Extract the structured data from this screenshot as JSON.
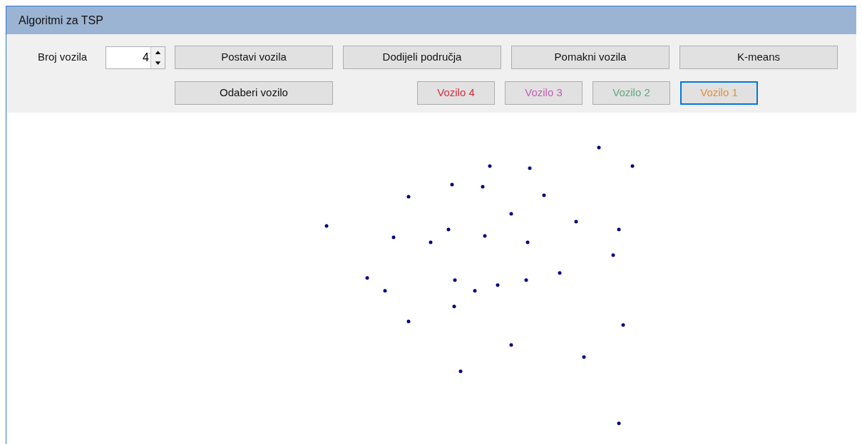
{
  "window": {
    "title": "Algoritmi za TSP"
  },
  "vehicle_count": {
    "label": "Broj vozila",
    "value": "4"
  },
  "actions": [
    {
      "label": "Postavi vozila"
    },
    {
      "label": "Dodijeli područja"
    },
    {
      "label": "Pomakni vozila"
    },
    {
      "label": "K-means"
    }
  ],
  "select_button": {
    "label": "Odaberi vozilo"
  },
  "vehicles": [
    {
      "label": "Vozilo 4",
      "color": "#d0303c",
      "selected": false
    },
    {
      "label": "Vozilo 3",
      "color": "#c060b0",
      "selected": false
    },
    {
      "label": "Vozilo 2",
      "color": "#60a880",
      "selected": false
    },
    {
      "label": "Vozilo 1",
      "color": "#e0903a",
      "selected": true
    }
  ]
}
